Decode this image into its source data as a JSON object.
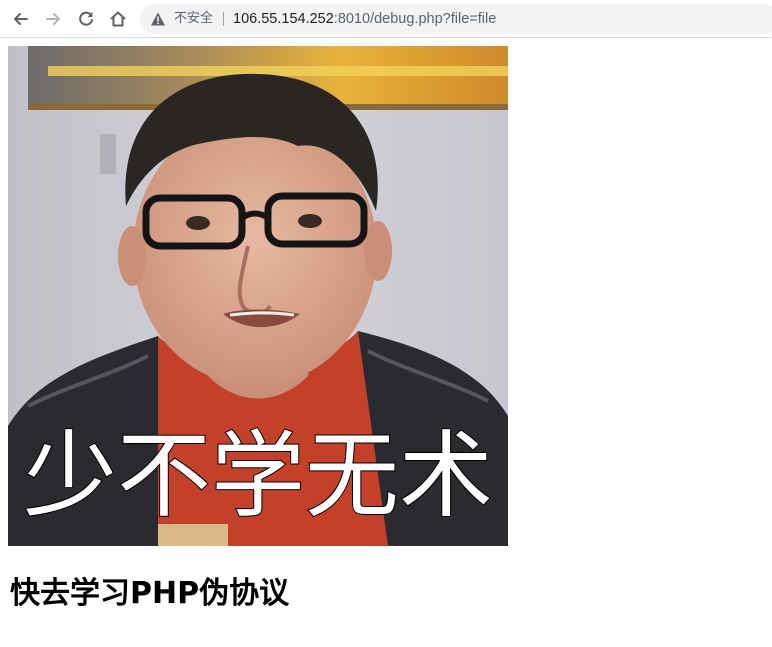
{
  "browser": {
    "security_label": "不安全",
    "url_host": "106.55.154.252",
    "url_rest": ":8010/debug.php?file=file",
    "icons": [
      "back-arrow-icon",
      "forward-arrow-icon",
      "reload-icon",
      "home-icon",
      "warning-triangle-icon"
    ]
  },
  "page": {
    "image_overlay_text": "少不学无术",
    "heading": "快去学习PHP伪协议"
  },
  "colors": {
    "omnibox_bg": "#f1f3f4",
    "shirt": "#c3402b",
    "wall": "#c9c9cf"
  }
}
